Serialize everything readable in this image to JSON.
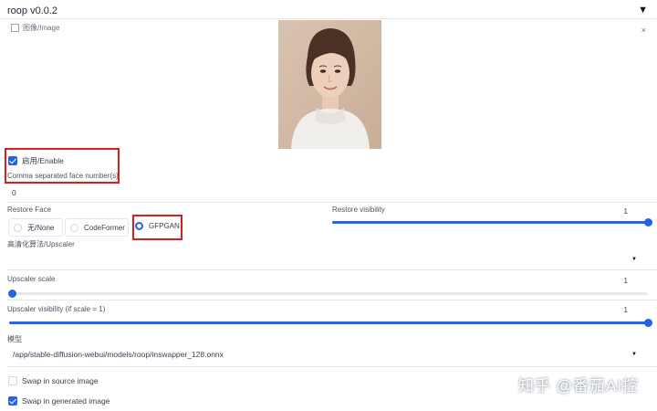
{
  "panel": {
    "title": "roop v0.0.2",
    "collapse_icon": "triangle-down-icon"
  },
  "image_block": {
    "label": "图像/Image",
    "close_glyph": "×"
  },
  "enable": {
    "label": "启用/Enable",
    "checked": true
  },
  "face_numbers": {
    "label": "Comma separated face number(s)",
    "value": "0"
  },
  "restore_face": {
    "label": "Restore Face",
    "options": [
      {
        "label": "无/None",
        "selected": false
      },
      {
        "label": "CodeFormer",
        "selected": false
      },
      {
        "label": "GFPGAN",
        "selected": true
      }
    ]
  },
  "restore_visibility": {
    "label": "Restore visibility",
    "value": "1",
    "level": 1.0
  },
  "upscaler": {
    "label": "高清化算法/Upscaler",
    "value": ""
  },
  "upscaler_scale": {
    "label": "Upscaler scale",
    "value": "1",
    "level": 0.0
  },
  "upscaler_visibility": {
    "label": "Upscaler visibility (if scale = 1)",
    "value": "1",
    "level": 1.0
  },
  "model": {
    "label": "模型",
    "value": "/app/stable-diffusion-webui/models/roop/inswapper_128.onnx"
  },
  "swap_source": {
    "label": "Swap in source image",
    "checked": false
  },
  "swap_generated": {
    "label": "Swap in generated image",
    "checked": true
  },
  "watermark": "知乎 @番茄AI控",
  "colors": {
    "accent": "#2563eb",
    "highlight": "#d81e1e"
  }
}
